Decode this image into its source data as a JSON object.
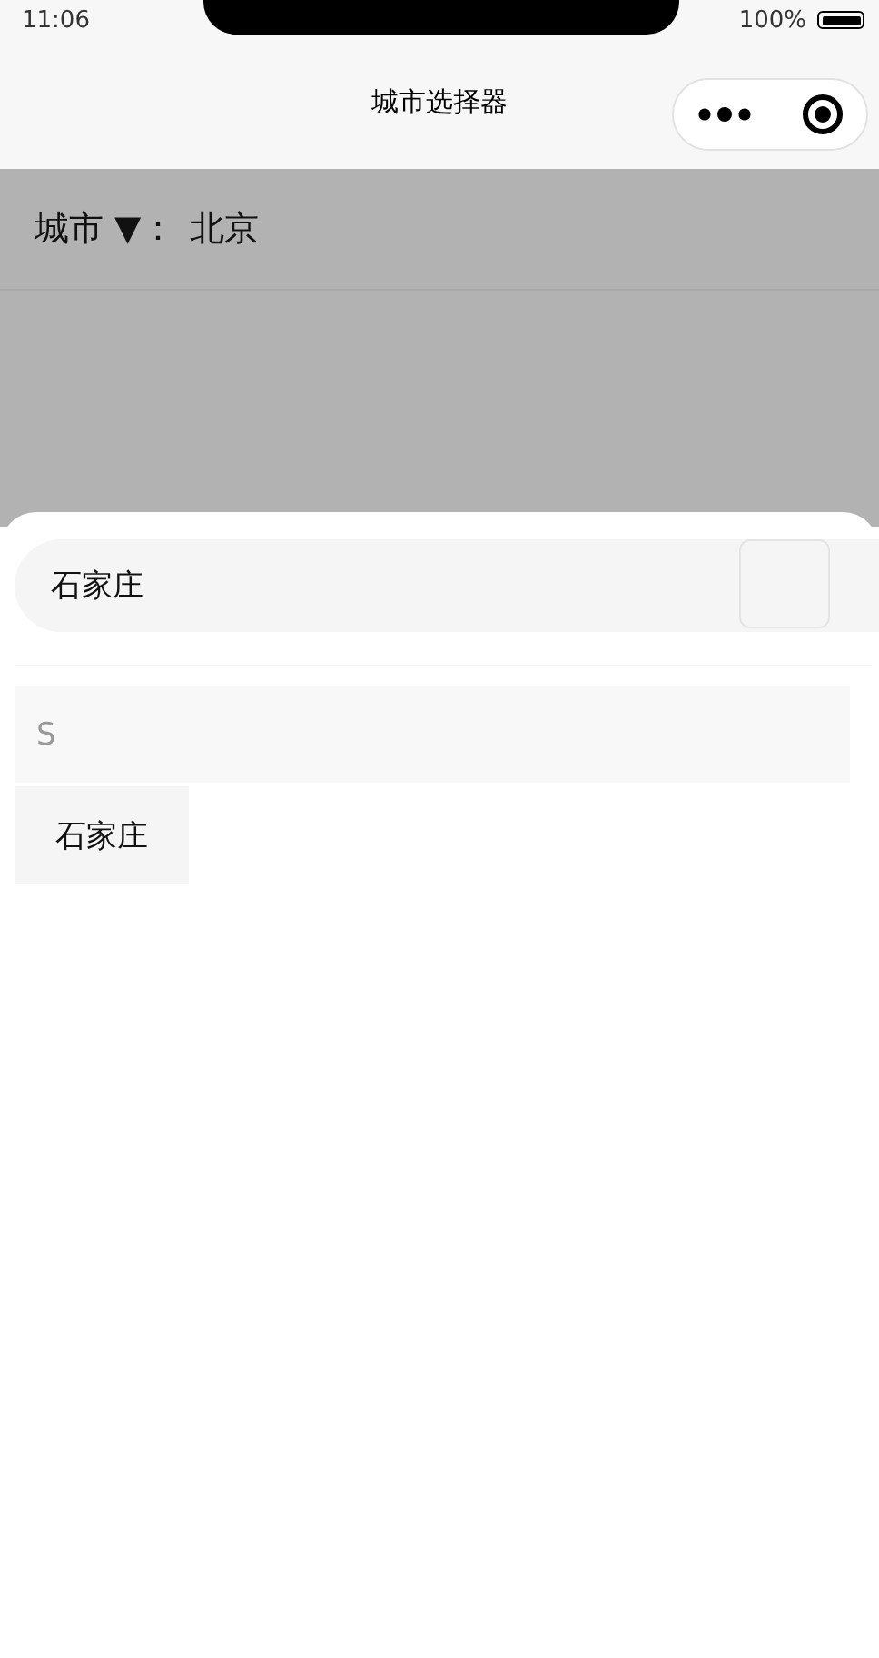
{
  "status_bar": {
    "time": "11:06",
    "battery": "100%"
  },
  "nav": {
    "title": "城市选择器"
  },
  "picker": {
    "label": "城市 ▼：",
    "value": "北京"
  },
  "search": {
    "value": "石家庄"
  },
  "groups": [
    {
      "letter": "S",
      "cities": [
        "石家庄"
      ]
    }
  ]
}
